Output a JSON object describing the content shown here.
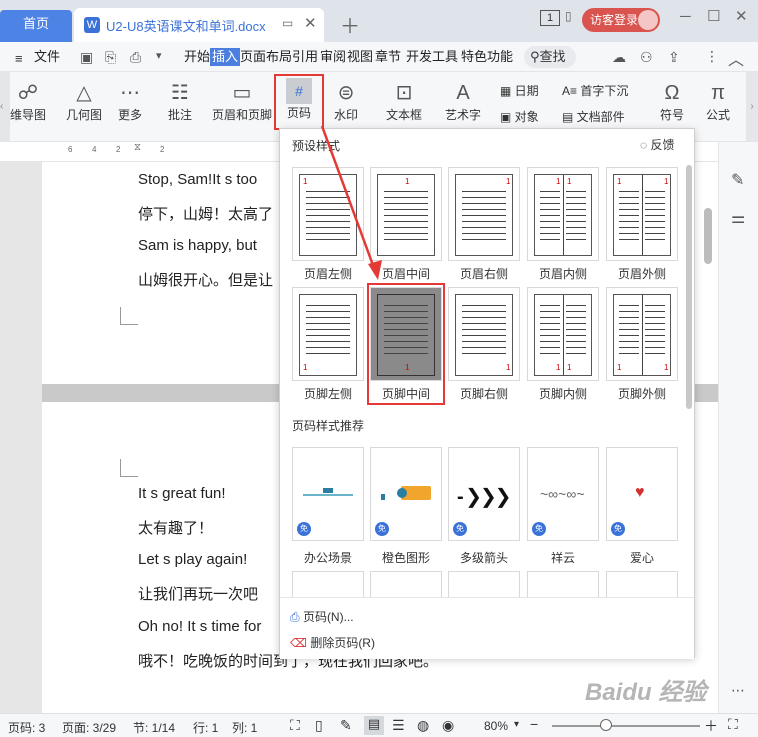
{
  "titlebar": {
    "home_tab": "首页",
    "doc_tab": "U2-U8英语课文和单词.docx",
    "doc_icon": "W",
    "page_num": "1",
    "login": "访客登录"
  },
  "menubar": {
    "file": "文件",
    "items": [
      "开始",
      "插入",
      "页面布局",
      "引用",
      "审阅",
      "视图",
      "章节",
      "开发工具",
      "特色功能"
    ],
    "search": "查找"
  },
  "ribbon": {
    "items": [
      "维导图",
      "几何图",
      "更多",
      "批注",
      "页眉和页脚",
      "页码",
      "水印",
      "文本框",
      "艺术字",
      "符号",
      "公式"
    ],
    "date": "日期",
    "object": "对象",
    "dropcap": "首字下沉",
    "docpart": "文档部件"
  },
  "ruler": {
    "marks": [
      "6",
      "4",
      "2",
      "2"
    ]
  },
  "document": {
    "lines1": [
      "Stop, Sam!It s    too",
      "停下，山姆！太高了",
      "Sam is happy, but",
      "山姆很开心。但是让"
    ],
    "lines2": [
      "It s great fun!",
      "太有趣了！",
      "Let s play again!",
      "让我们再玩一次吧",
      "Oh no! It s time for",
      "哦不！吃晚饭的时间到了，现在我们回家吧。"
    ]
  },
  "panel": {
    "preset_title": "预设样式",
    "feedback": "反馈",
    "header_styles": [
      "页眉左侧",
      "页眉中间",
      "页眉右侧",
      "页眉内侧",
      "页眉外侧"
    ],
    "footer_styles": [
      "页脚左侧",
      "页脚中间",
      "页脚右侧",
      "页脚内侧",
      "页脚外侧"
    ],
    "recommend_title": "页码样式推荐",
    "recommend": [
      "办公场景",
      "橙色图形",
      "多级箭头",
      "祥云",
      "爱心"
    ],
    "free_badge": "免",
    "number_number": "1",
    "page_number_item": "页码(N)...",
    "delete_page_number": "删除页码(R)"
  },
  "statusbar": {
    "page": "页码: 3",
    "pages": "页面: 3/29",
    "section": "节: 1/14",
    "row": "行: 1",
    "col": "列: 1",
    "zoom": "80%"
  },
  "watermark": "Baidu 经验",
  "colors": {
    "accent": "#4a7fe0",
    "highlight": "#e53935"
  }
}
